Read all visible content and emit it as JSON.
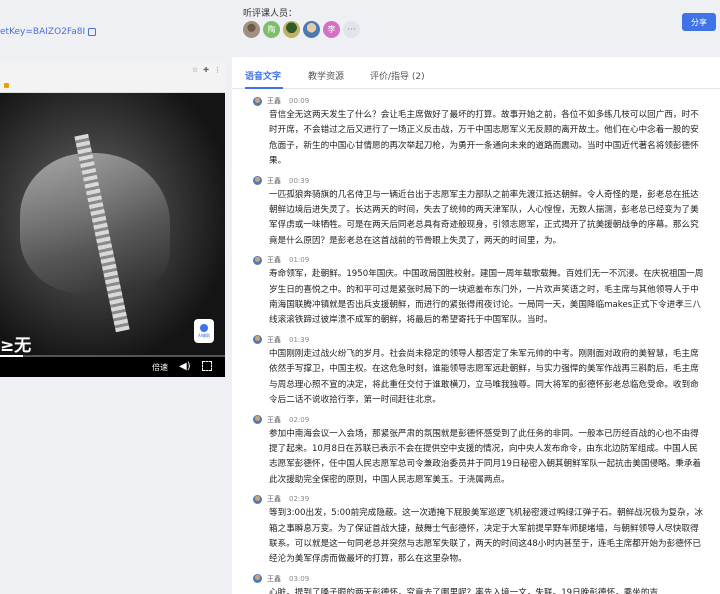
{
  "header": {
    "share_key": "etKey=BAIZO2Fa8I",
    "listeners_label": "听评课人员：",
    "listeners": [
      "",
      "陶",
      "",
      "",
      "李"
    ],
    "more_label": "···",
    "share_button": "分享"
  },
  "player": {
    "subtitle": "≥无",
    "assist_label": "AI辅助",
    "speed_label": "倍速",
    "progress": 0.1
  },
  "tabs": [
    {
      "label": "语音文字",
      "active": true
    },
    {
      "label": "教学资源",
      "active": false
    },
    {
      "label": "评价/指导 (2)",
      "active": false
    }
  ],
  "entries": [
    {
      "name": "王鑫",
      "time": "00:09",
      "text": "音信全无这两天发生了什么？会让毛主席做好了最坏的打算。故事开始之前，各位不如多练几枝可以回广西，时不时开席，不会错过之后又进行了一场正义反击战，万千中国志愿军义无反顾的离开故土。他们在心中念着一股的安危面子，新生的中国心甘情愿的再次举起刀枪，为勇开一条通向未来的道路而震动。当时中国近代著名将领彭德怀果。"
    },
    {
      "name": "王鑫",
      "time": "00:39",
      "text": "一匹孤狼奔骑旗的几名侍卫与一辆近台出于志愿军主力部队之前率先渡江抵达朝鲜。令人奇怪的是，彭老总在抵达朝鲜边境后进失灵了。长达两天的时间，失去了统帅的两天津军队，人心惶惶，无数人揣测，彭老总已经变为了美军俘虏或一味牺牲。可是在两天后同老总具有奇迹般现身，引领志愿军，正式揭开了抗美援朝战争的序幕。那么究竟是什么原因？是彭老总在这首战前的节骨眼上失灵了，两天的时间里，为。"
    },
    {
      "name": "王鑫",
      "time": "01:09",
      "text": "寿命领军，赴朝鲜。1950年国庆。中国政局国胜校射。建国一周年载歌载舞。百姓们无一不沉浸。在庆祝祖国一周岁生日的喜悦之中。的和平可过是紧张时局下的一块遮羞布东门外，一片欢声笑语之时，毛主席与其他领导人于中南海国联腾冲镇就是否出兵支援朝鲜，而进行的紧张得闹夜讨论。一局同一天，美国降临makes正式下令进孝三八线滚滚铁蹄过彼岸溃不成军的朝鲜，将最后的希望寄托于中国军队。当时。"
    },
    {
      "name": "王鑫",
      "time": "01:39",
      "text": "中国刚刚走过战火纷飞的岁月。社会尚未稳定的领导人都否定了朱军元帅的中考。刚刚面对政府的美智慧，毛主席依然手写撑卫，中国主权。在这危急时刻，谁能领导志愿军远赴朝鲜，与实力强悍的美军作战再三斟酌后，毛主席与周总理心照不宣的决定，将此重任交付于谁敢横刀，立马唯我独尊。同大将军的彭德怀彭老总临危受命。收到命令后二话不说收拾行李，第一时间赶往北京。"
    },
    {
      "name": "王鑫",
      "time": "02:09",
      "text": "参加中南海会议一入会场，那紧张严肃的氛围就是彭德怀感受到了此任务的非同。一般本已历经百战的心也不由得提了起来。10月8日在苏联已表示不会在提供空中支援的情况，向中央人发布命令，由东北边防军组成。中国人民志愿军彭德怀，任中国人民志愿军总司令兼政治委员并于同月19日秘密入朝其朝鲜军队一起抗击美国侵略。秉承着此次援助完全保密的原则，中国人民志愿军美玉。于浇属两点。"
    },
    {
      "name": "王鑫",
      "time": "02:39",
      "text": "等到3:00出发，5:00前完成隐蔽。这一次遁掩下屁股美军巡逻飞机秘密渡过鸭绿江弹子石。朝鲜战况极为复杂，冰箱之事瞬息万变。为了保证首战大捷，鼓舞士气彭德怀，决定于大军前提早野车师腿堵墙，与朝鲜领导人尽快取得联系。可以就是这一句同老总并突然与志愿军失联了，两天的时间这48小时内甚至于，连毛主席都开始为彭德怀已经沦为美军俘虏而做最坏的打算，那么在这里杂物。"
    },
    {
      "name": "王鑫",
      "time": "03:09",
      "text": "心脏。提到了嗓子眼的两天彭德怀，究竟去了哪里呢？率先入境一文，失联。19日晚彭德怀，乘坐的吉"
    }
  ]
}
